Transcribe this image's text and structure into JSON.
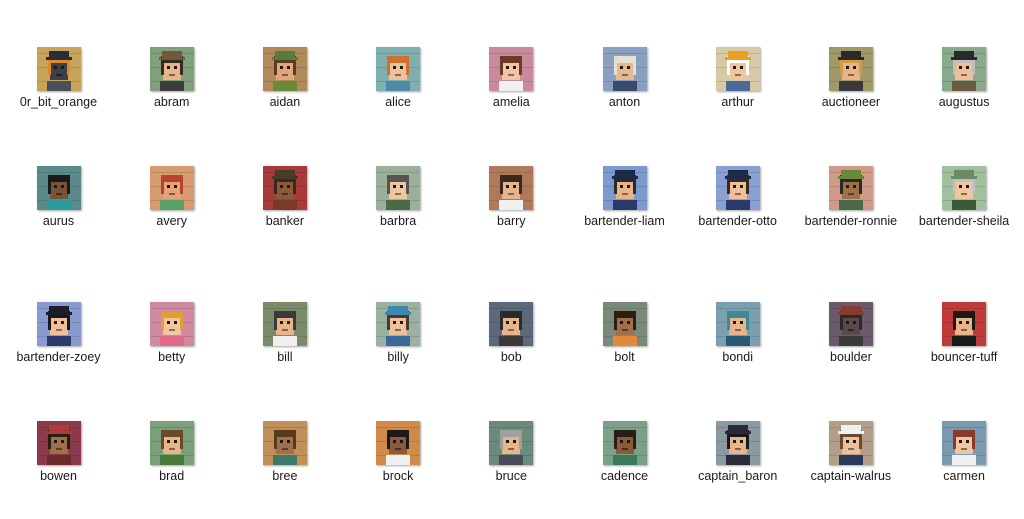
{
  "files": [
    {
      "name": "0r_bit_orange",
      "icon": "robot-avatar-icon",
      "bg": "#c8a35a",
      "skin": "#3b3f4a",
      "hair": "#e08a2a",
      "hat": "#2a2d35",
      "shirt": "#4a4f5c"
    },
    {
      "name": "abram",
      "icon": "character-avatar-icon",
      "bg": "#7fa07a",
      "skin": "#e8b48a",
      "hair": "#3a2a1e",
      "hat": "#6e5a3a",
      "shirt": "#3c3c3c"
    },
    {
      "name": "aidan",
      "icon": "character-avatar-icon",
      "bg": "#b08a5a",
      "skin": "#e2a57c",
      "hair": "#5b3b22",
      "hat": "#5a7a3a",
      "shirt": "#6a8a3a"
    },
    {
      "name": "alice",
      "icon": "character-avatar-icon",
      "bg": "#7fb0b0",
      "skin": "#f0c09a",
      "hair": "#d0702e",
      "hat": "",
      "shirt": "#4f8aa5"
    },
    {
      "name": "amelia",
      "icon": "character-avatar-icon",
      "bg": "#c98a9a",
      "skin": "#f2c6a2",
      "hair": "#6b3a28",
      "hat": "",
      "shirt": "#f0f0f0"
    },
    {
      "name": "anton",
      "icon": "character-avatar-icon",
      "bg": "#8aa0c0",
      "skin": "#e6b892",
      "hair": "#e8e0d0",
      "hat": "",
      "shirt": "#3a4a6a"
    },
    {
      "name": "arthur",
      "icon": "character-avatar-icon",
      "bg": "#d6c9a3",
      "skin": "#efc6a0",
      "hair": "#ffffff",
      "hat": "#e8a020",
      "shirt": "#4a6a9a"
    },
    {
      "name": "auctioneer",
      "icon": "character-avatar-icon",
      "bg": "#a09a6a",
      "skin": "#e8b48a",
      "hair": "#d69a40",
      "hat": "#2a2a2a",
      "shirt": "#3a3a3a"
    },
    {
      "name": "augustus",
      "icon": "character-avatar-icon",
      "bg": "#8aa88a",
      "skin": "#f0c09a",
      "hair": "#bfbfbf",
      "hat": "#2a2a2a",
      "shirt": "#6a5a40"
    },
    {
      "name": "aurus",
      "icon": "character-avatar-icon",
      "bg": "#5a8a8a",
      "skin": "#7a5238",
      "hair": "#1a1a1a",
      "hat": "",
      "shirt": "#2a9a9a"
    },
    {
      "name": "avery",
      "icon": "character-avatar-icon",
      "bg": "#d89a70",
      "skin": "#e8a27a",
      "hair": "#b2452a",
      "hat": "",
      "shirt": "#5aa06a"
    },
    {
      "name": "banker",
      "icon": "character-avatar-icon",
      "bg": "#a83a3a",
      "skin": "#8a5a3a",
      "hair": "#3a2a1e",
      "hat": "#4a3a2a",
      "shirt": "#7a3a2a"
    },
    {
      "name": "barbra",
      "icon": "character-avatar-icon",
      "bg": "#9ab09a",
      "skin": "#f0c6a0",
      "hair": "#555555",
      "hat": "",
      "shirt": "#4a6a4a"
    },
    {
      "name": "barry",
      "icon": "character-avatar-icon",
      "bg": "#b07a5a",
      "skin": "#e8b48a",
      "hair": "#3a2a1e",
      "hat": "",
      "shirt": "#f0f0f0"
    },
    {
      "name": "bartender-liam",
      "icon": "character-avatar-icon",
      "bg": "#7a9ad0",
      "skin": "#e8b48a",
      "hair": "#2a2a2a",
      "hat": "#1e2a4a",
      "shirt": "#2a3a6a"
    },
    {
      "name": "bartender-otto",
      "icon": "character-avatar-icon",
      "bg": "#8aa0d0",
      "skin": "#f0c09a",
      "hair": "#3a2a1e",
      "hat": "#1e2a4a",
      "shirt": "#2a3a6a"
    },
    {
      "name": "bartender-ronnie",
      "icon": "character-avatar-icon",
      "bg": "#d09a8a",
      "skin": "#a0704a",
      "hair": "#2a2a2a",
      "hat": "#6a8a3a",
      "shirt": "#4a6a4a"
    },
    {
      "name": "bartender-sheila",
      "icon": "character-avatar-icon",
      "bg": "#a0c0a0",
      "skin": "#f0c6a0",
      "hair": "#c0c0c0",
      "hat": "#6a8a6a",
      "shirt": "#3a5a3a"
    },
    {
      "name": "bartender-zoey",
      "icon": "character-avatar-icon",
      "bg": "#8a9ad0",
      "skin": "#f0c09a",
      "hair": "#1a1a1a",
      "hat": "#1e1e2a",
      "shirt": "#2a3a6a"
    },
    {
      "name": "betty",
      "icon": "character-avatar-icon",
      "bg": "#d08aa0",
      "skin": "#f2c6a2",
      "hair": "#e0a030",
      "hat": "",
      "shirt": "#e06a8a"
    },
    {
      "name": "bill",
      "icon": "character-avatar-icon",
      "bg": "#7a8a6a",
      "skin": "#e8b48a",
      "hair": "#3a3a3a",
      "hat": "",
      "shirt": "#f0f0f0"
    },
    {
      "name": "billy",
      "icon": "character-avatar-icon",
      "bg": "#9ab0a0",
      "skin": "#f0c09a",
      "hair": "#4a3a2a",
      "hat": "#3a8ab0",
      "shirt": "#3a6a9a"
    },
    {
      "name": "bob",
      "icon": "character-avatar-icon",
      "bg": "#5a6a7a",
      "skin": "#e8b48a",
      "hair": "#2a2a2a",
      "hat": "",
      "shirt": "#3a3a3a"
    },
    {
      "name": "bolt",
      "icon": "character-avatar-icon",
      "bg": "#7a8a7a",
      "skin": "#a0704a",
      "hair": "#2a1e14",
      "hat": "",
      "shirt": "#e08a3a"
    },
    {
      "name": "bondi",
      "icon": "character-avatar-icon",
      "bg": "#7aa0b0",
      "skin": "#e8b48a",
      "hair": "#3a8a9a",
      "hat": "",
      "shirt": "#2a5a7a"
    },
    {
      "name": "boulder",
      "icon": "character-avatar-icon",
      "bg": "#6a5a6a",
      "skin": "#5a4a4a",
      "hair": "#2a2a2a",
      "hat": "#8a3a2a",
      "shirt": "#3a3a3a"
    },
    {
      "name": "bouncer-tuff",
      "icon": "character-avatar-icon",
      "bg": "#c03a3a",
      "skin": "#e8b48a",
      "hair": "#1a1a1a",
      "hat": "",
      "shirt": "#1a1a1a"
    },
    {
      "name": "bowen",
      "icon": "character-avatar-icon",
      "bg": "#8a3a4a",
      "skin": "#a0704a",
      "hair": "#2a1e14",
      "hat": "#b03a3a",
      "shirt": "#6a2a2a"
    },
    {
      "name": "brad",
      "icon": "character-avatar-icon",
      "bg": "#7aa07a",
      "skin": "#e8b48a",
      "hair": "#6a4a2a",
      "hat": "",
      "shirt": "#4a7a3a"
    },
    {
      "name": "bree",
      "icon": "character-avatar-icon",
      "bg": "#c0905a",
      "skin": "#a0704a",
      "hair": "#5a3a1e",
      "hat": "",
      "shirt": "#3a7a6a"
    },
    {
      "name": "brock",
      "icon": "character-avatar-icon",
      "bg": "#d08a4a",
      "skin": "#8a5a3a",
      "hair": "#1a1a1a",
      "hat": "",
      "shirt": "#f0f0f0"
    },
    {
      "name": "bruce",
      "icon": "character-avatar-icon",
      "bg": "#6a8a7a",
      "skin": "#e8b48a",
      "hair": "#a0a0a0",
      "hat": "",
      "shirt": "#4a4a5a"
    },
    {
      "name": "cadence",
      "icon": "character-avatar-icon",
      "bg": "#7aa08a",
      "skin": "#8a5a3a",
      "hair": "#2a1e14",
      "hat": "",
      "shirt": "#3a7a5a"
    },
    {
      "name": "captain_baron",
      "icon": "character-avatar-icon",
      "bg": "#8a9aa0",
      "skin": "#e8b48a",
      "hair": "#1a1a1a",
      "hat": "#2a2a3a",
      "shirt": "#2a2a3a"
    },
    {
      "name": "captain-walrus",
      "icon": "character-avatar-icon",
      "bg": "#b0a08a",
      "skin": "#f0c09a",
      "hair": "#6a4a2a",
      "hat": "#f0f0f0",
      "shirt": "#2a3a5a"
    },
    {
      "name": "carmen",
      "icon": "character-avatar-icon",
      "bg": "#7a9ab0",
      "skin": "#f0c6a0",
      "hair": "#8a3a2a",
      "hat": "",
      "shirt": "#f0f0f0"
    }
  ]
}
